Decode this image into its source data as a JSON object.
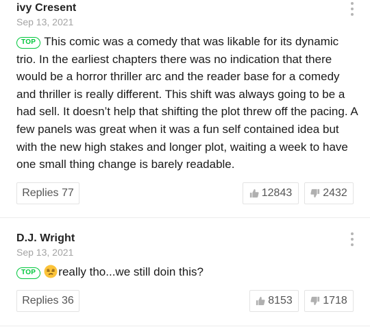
{
  "comments": [
    {
      "author": "ivy Cresent",
      "date": "Sep 13, 2021",
      "badge": "TOP",
      "text": "This comic was a comedy that was likable for its dynamic trio. In the earliest chapters there was no indication that there would be a horror thriller arc and the reader base for a comedy and thriller is really different. This shift was always going to be a had sell. It doesn’t help that shifting the plot threw off the pacing. A few panels was great when it was a fun self contained idea but with the new high stakes and longer plot, waiting a week to have one small thing change is barely readable.",
      "replies_label": "Replies 77",
      "likes": "12843",
      "dislikes": "2432"
    },
    {
      "author": "D.J. Wright",
      "date": "Sep 13, 2021",
      "badge": "TOP",
      "emoji": "unamused-face-icon",
      "text": "really tho...we still doin this?",
      "replies_label": "Replies 36",
      "likes": "8153",
      "dislikes": "1718"
    }
  ],
  "colors": {
    "badge_green": "#00c73c",
    "date_gray": "#a3a3a3",
    "border_gray": "#e3e3e3"
  }
}
